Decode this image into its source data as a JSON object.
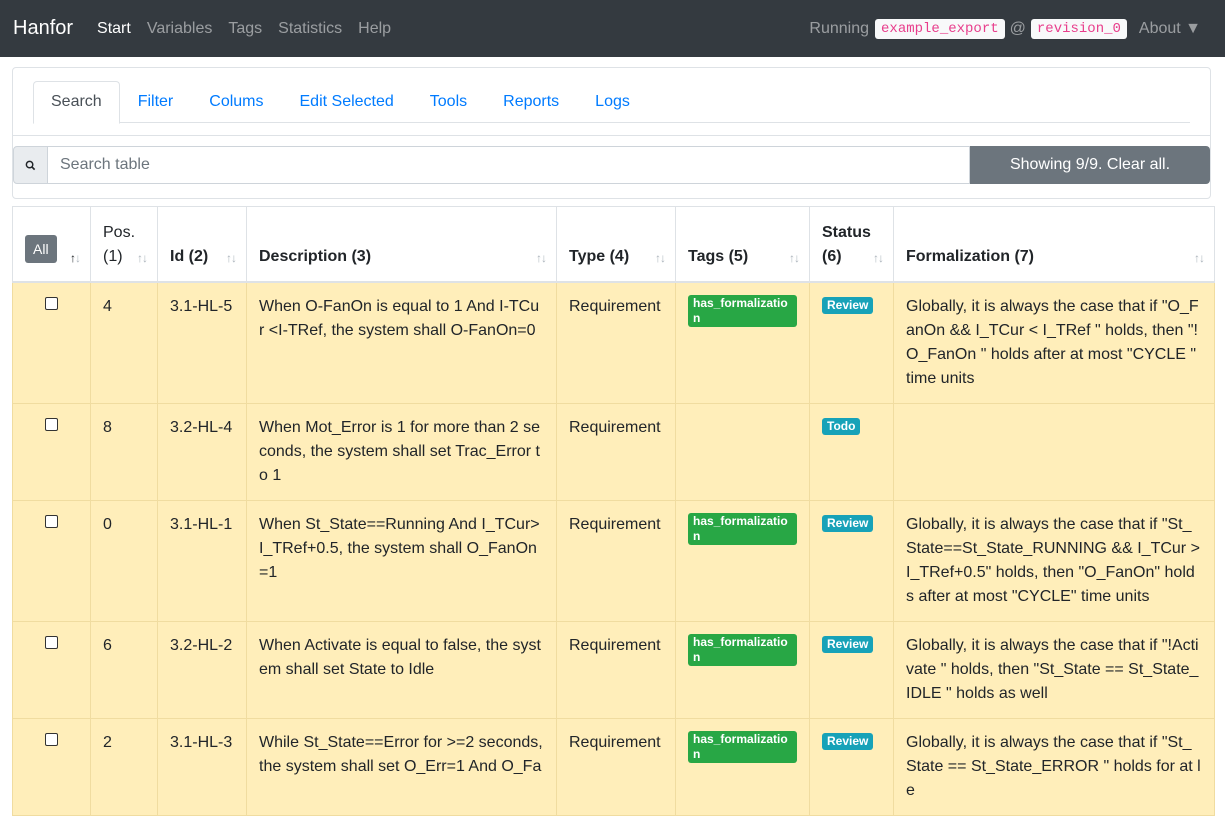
{
  "navbar": {
    "brand": "Hanfor",
    "links": [
      "Start",
      "Variables",
      "Tags",
      "Statistics",
      "Help"
    ],
    "running_label": "Running",
    "export_name": "example_export",
    "at": "@",
    "revision": "revision_0",
    "about": "About ▼"
  },
  "tabs": [
    "Search",
    "Filter",
    "Colums",
    "Edit Selected",
    "Tools",
    "Reports",
    "Logs"
  ],
  "search": {
    "icon": "search-icon",
    "placeholder": "Search table",
    "clear_label": "Showing 9/9. Clear all."
  },
  "table": {
    "all_button": "All",
    "headers": {
      "pos_line1": "Pos.",
      "pos_line2": "(1)",
      "id": "Id (2)",
      "description": "Description (3)",
      "type": "Type (4)",
      "tags": "Tags (5)",
      "status_line1": "Status",
      "status_line2": "(6)",
      "formalization": "Formalization (7)"
    },
    "rows": [
      {
        "pos": "4",
        "id": "3.1-HL-5",
        "description": "When O-FanOn is equal to 1 And I-TCur <I-TRef, the system shall O-FanOn=0",
        "type": "Requirement",
        "tag": "has_formalization",
        "status": "Review",
        "formalization": "Globally, it is always the case that if \"O_FanOn && I_TCur  < I_TRef \" holds, then \"!O_FanOn \" holds after at most \"CYCLE \" time units"
      },
      {
        "pos": "8",
        "id": "3.2-HL-4",
        "description": "When Mot_Error is 1 for more than 2 seconds, the system shall set Trac_Error to 1",
        "type": "Requirement",
        "tag": "",
        "status": "Todo",
        "formalization": ""
      },
      {
        "pos": "0",
        "id": "3.1-HL-1",
        "description": "When St_State==Running And I_TCur>I_TRef+0.5, the system shall O_FanOn=1",
        "type": "Requirement",
        "tag": "has_formalization",
        "status": "Review",
        "formalization": "Globally, it is always the case that if \"St_State==St_State_RUNNING && I_TCur > I_TRef+0.5\" holds, then \"O_FanOn\" holds after at most \"CYCLE\" time units"
      },
      {
        "pos": "6",
        "id": "3.2-HL-2",
        "description": "When Activate is equal to false, the system shall set State to Idle",
        "type": "Requirement",
        "tag": "has_formalization",
        "status": "Review",
        "formalization": "Globally, it is always the case that if \"!Activate \" holds, then \"St_State == St_State_IDLE \" holds as well"
      },
      {
        "pos": "2",
        "id": "3.1-HL-3",
        "description": "While St_State==Error for >=2 seconds, the system shall set O_Err=1 And O_Fa",
        "type": "Requirement",
        "tag": "has_formalization",
        "status": "Review",
        "formalization": "Globally, it is always the case that if \"St_State == St_State_ERROR \" holds for at le"
      }
    ]
  },
  "colors": {
    "navbar_bg": "#343a40",
    "row_bg": "#ffeeba",
    "tag_badge": "#28a745",
    "status_badge": "#17a2b8",
    "clear_button": "#6c757d"
  }
}
